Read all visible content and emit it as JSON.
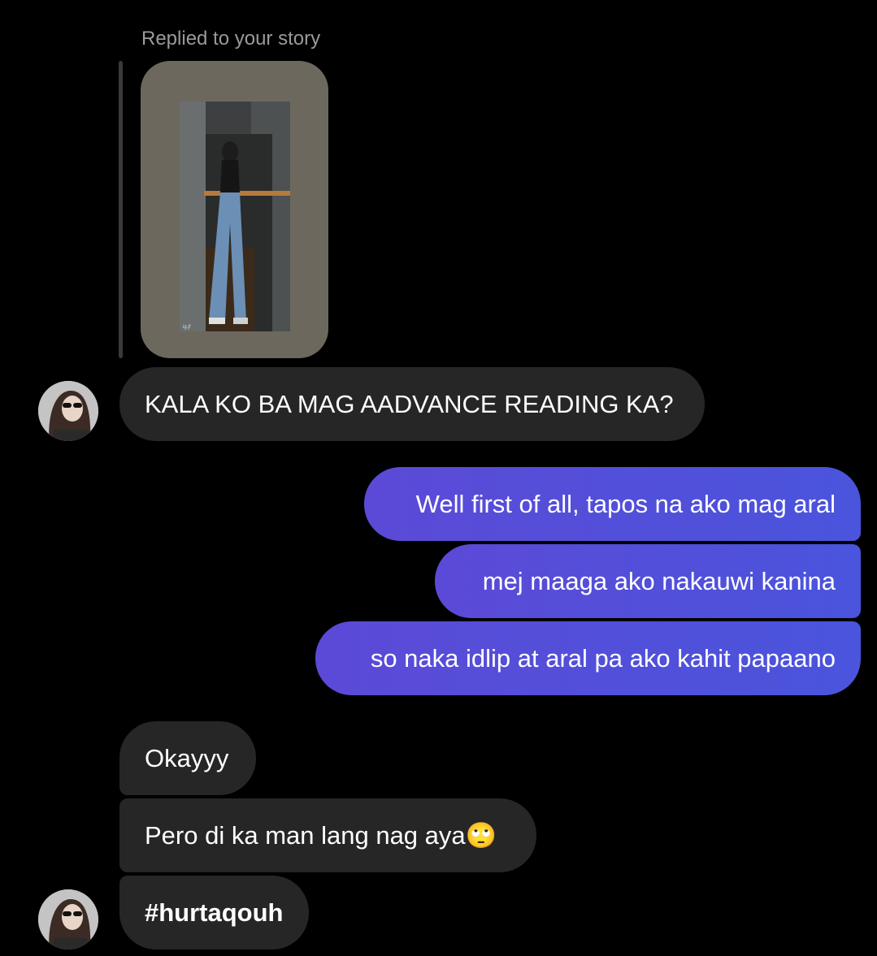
{
  "story_reply": {
    "label": "Replied to your story",
    "photo_caption": "ig.jf"
  },
  "messages": [
    {
      "from": "them",
      "text": "KALA KO BA MAG AADVANCE READING KA?"
    },
    {
      "from": "me",
      "text": "Well first of all, tapos na ako mag aral"
    },
    {
      "from": "me",
      "text": "mej maaga ako nakauwi kanina"
    },
    {
      "from": "me",
      "text": "so naka idlip at aral pa ako kahit papaano"
    },
    {
      "from": "them",
      "text": "Okayyy"
    },
    {
      "from": "them",
      "text": "Pero di ka man lang nag aya🙄"
    },
    {
      "from": "them",
      "text": "#hurtaqouh"
    }
  ],
  "colors": {
    "background": "#000000",
    "incoming_bubble": "#262626",
    "outgoing_bubble_start": "#5b4ad7",
    "outgoing_bubble_end": "#4a54dc",
    "story_card": "#6d685e"
  }
}
